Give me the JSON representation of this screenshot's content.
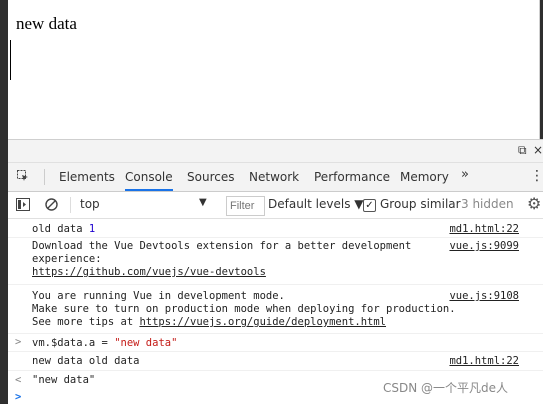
{
  "page": {
    "heading": "new data"
  },
  "devtools": {
    "dock": {
      "undock_icon": "undock-icon",
      "close_icon": "close-icon",
      "close_glyph": "×"
    },
    "tabs": [
      "Elements",
      "Console",
      "Sources",
      "Network",
      "Performance",
      "Memory"
    ],
    "active_tab": "Console",
    "more_tabs": "»",
    "toolbar": {
      "context": "top",
      "filter_placeholder": "Filter",
      "levels": "Default levels",
      "group_similar_label": "Group similar",
      "group_similar_checked": true,
      "hidden_count": "3 hidden"
    }
  },
  "console": {
    "messages": [
      {
        "text": "old data ",
        "num": "1",
        "source": "md1.html:22"
      },
      {
        "line1": "Download the Vue Devtools extension for a better development",
        "line2": "experience:",
        "link": "https://github.com/vuejs/vue-devtools",
        "source": "vue.js:9099"
      },
      {
        "line1": "You are running Vue in development mode.",
        "line2": "Make sure to turn on production mode when deploying for production.",
        "line3_prefix": "See more tips at ",
        "link": "https://vuejs.org/guide/deployment.html",
        "source": "vue.js:9108"
      },
      {
        "input_prefix": "vm.$data.a = ",
        "input_str": "\"new data\""
      },
      {
        "text": "new data old data",
        "source": "md1.html:22"
      },
      {
        "result": "\"new data\""
      }
    ],
    "prompt_symbol": ">",
    "result_symbol": "<"
  },
  "watermark": "CSDN @一个平凡de人",
  "colors": {
    "accent": "#1a73e8",
    "string": "#c41a16",
    "number": "#1c00cf"
  }
}
